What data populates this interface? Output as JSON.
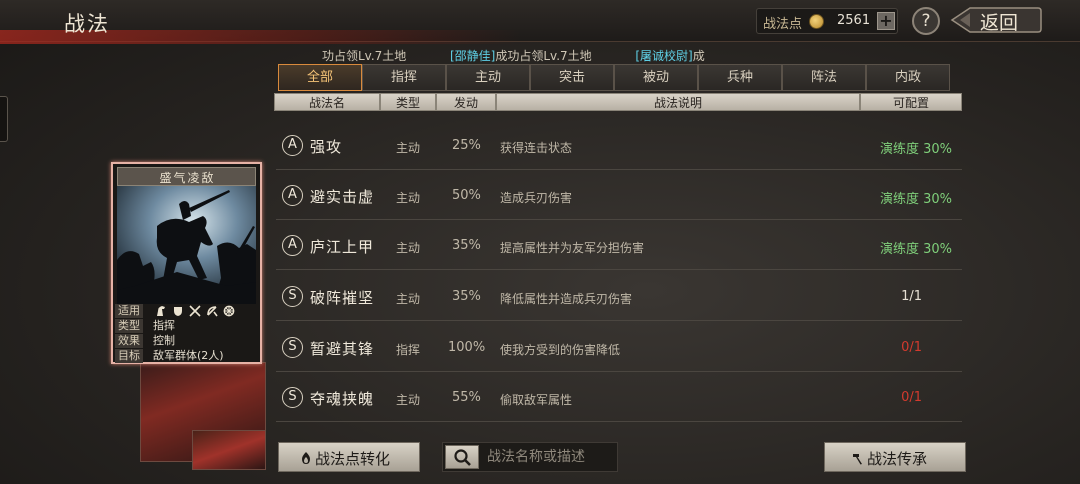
{
  "header": {
    "title": "战法",
    "points_label": "战法点",
    "points_value": "2561",
    "plus_label": "+",
    "help_label": "?",
    "back_label": "返回"
  },
  "notice": {
    "left_text": "功占领Lv.7土地",
    "name_1": "[邵静佳]",
    "mid_text": "成功占领Lv.7土地",
    "name_2": "[屠诚校尉]",
    "right_text": "成"
  },
  "tabs": [
    "全部",
    "指挥",
    "主动",
    "突击",
    "被动",
    "兵种",
    "阵法",
    "内政"
  ],
  "columns": [
    "战法名",
    "类型",
    "发动",
    "战法说明",
    "可配置"
  ],
  "tactics": [
    {
      "grade": "A",
      "name": "强攻",
      "type": "主动",
      "rate": "25%",
      "desc": "获得连击状态",
      "config": "演练度 30%",
      "config_color": "#7fcf7a"
    },
    {
      "grade": "A",
      "name": "避实击虚",
      "type": "主动",
      "rate": "50%",
      "desc": "造成兵刃伤害",
      "config": "演练度 30%",
      "config_color": "#7fcf7a"
    },
    {
      "grade": "A",
      "name": "庐江上甲",
      "type": "主动",
      "rate": "35%",
      "desc": "提高属性并为友军分担伤害",
      "config": "演练度 30%",
      "config_color": "#7fcf7a"
    },
    {
      "grade": "S",
      "name": "破阵摧坚",
      "type": "主动",
      "rate": "35%",
      "desc": "降低属性并造成兵刃伤害",
      "config": "1/1",
      "config_color": "#e6e0d4"
    },
    {
      "grade": "S",
      "name": "暂避其锋",
      "type": "指挥",
      "rate": "100%",
      "desc": "使我方受到的伤害降低",
      "config": "0/1",
      "config_color": "#d23a2e"
    },
    {
      "grade": "S",
      "name": "夺魂挟魄",
      "type": "主动",
      "rate": "55%",
      "desc": "偷取敌军属性",
      "config": "0/1",
      "config_color": "#d23a2e"
    }
  ],
  "card": {
    "title": "盛气凌敌",
    "applicable_label": "适用",
    "type_label": "类型",
    "type_value": "指挥",
    "effect_label": "效果",
    "effect_value": "控制",
    "target_label": "目标",
    "target_value": "敌军群体(2人)",
    "unit_icons": [
      "cavalry-icon",
      "shield-icon",
      "crossed-spears-icon",
      "bow-icon",
      "chariot-wheel-icon"
    ]
  },
  "bottom": {
    "convert_label": "战法点转化",
    "search_placeholder": "战法名称或描述",
    "inherit_label": "战法传承"
  }
}
